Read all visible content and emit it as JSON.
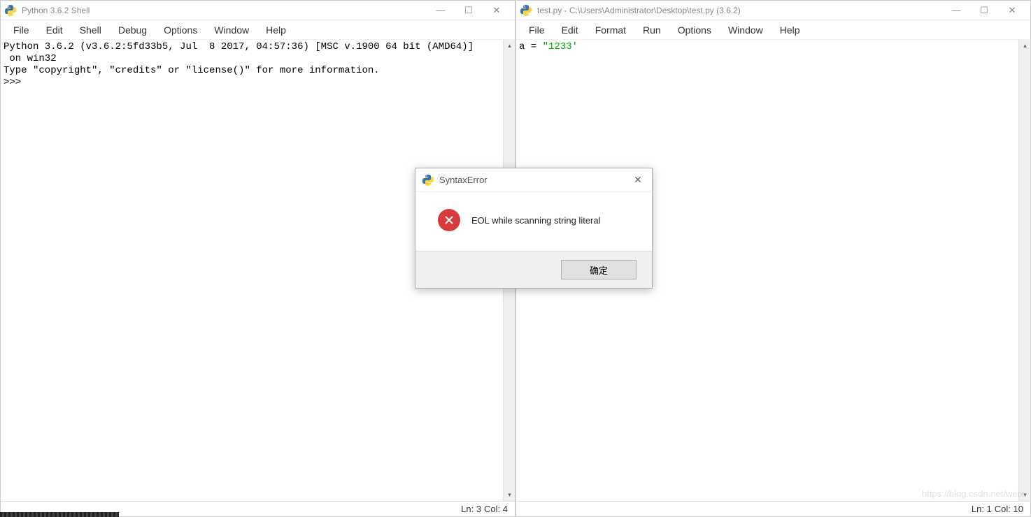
{
  "shell": {
    "title": "Python 3.6.2 Shell",
    "menu": [
      "File",
      "Edit",
      "Shell",
      "Debug",
      "Options",
      "Window",
      "Help"
    ],
    "line1": "Python 3.6.2 (v3.6.2:5fd33b5, Jul  8 2017, 04:57:36) [MSC v.1900 64 bit (AMD64)]",
    "line2": " on win32",
    "line3": "Type \"copyright\", \"credits\" or \"license()\" for more information.",
    "prompt": ">>> ",
    "status_ln": "Ln: 3",
    "status_col": "Col: 4"
  },
  "editor": {
    "title": "test.py - C:\\Users\\Administrator\\Desktop\\test.py (3.6.2)",
    "menu": [
      "File",
      "Edit",
      "Format",
      "Run",
      "Options",
      "Window",
      "Help"
    ],
    "code_prefix": "a = ",
    "code_string": "\"1233'",
    "status_ln": "Ln: 1",
    "status_col": "Col: 10"
  },
  "dialog": {
    "title": "SyntaxError",
    "message": "EOL while scanning string literal",
    "ok_label": "确定"
  },
  "watermark": "https://blog.csdn.net/weix"
}
